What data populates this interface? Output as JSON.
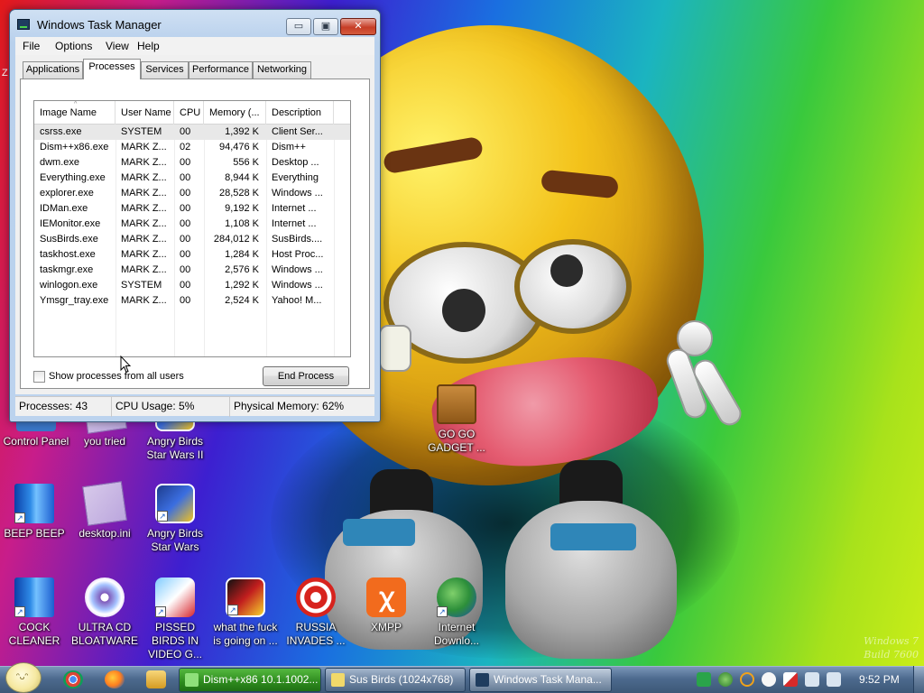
{
  "desktop": {
    "stray_text": "Z",
    "watermark": [
      "Windows 7",
      "Build 7600"
    ],
    "icons": [
      {
        "label": "Control Panel",
        "icon": "control-panel-icon"
      },
      {
        "label": "you tried",
        "icon": "text-file-icon"
      },
      {
        "label": "Angry Birds Star Wars II",
        "icon": "angry-birds-star-wars-icon"
      },
      {
        "label": "BEEP BEEP",
        "icon": "book-icon"
      },
      {
        "label": "desktop.ini",
        "icon": "ini-file-icon"
      },
      {
        "label": "Angry Birds Star Wars",
        "icon": "angry-birds-star-wars-icon"
      },
      {
        "label": "COCK CLEANER",
        "icon": "book-icon"
      },
      {
        "label": "ULTRA CD BLOATWARE",
        "icon": "cd-disc-icon"
      },
      {
        "label": "PISSED BIRDS IN VIDEO G...",
        "icon": "angry-bird-icon"
      },
      {
        "label": "what the fuck is going on ...",
        "icon": "angry-birds-space-icon"
      },
      {
        "label": "RUSSIA INVADES ...",
        "icon": "radiation-icon"
      },
      {
        "label": "XMPP",
        "icon": "xampp-icon"
      },
      {
        "label": "Internet Downlo...",
        "icon": "idm-globe-icon"
      },
      {
        "label": "GO GO GADGET ...",
        "icon": "briefcase-icon"
      }
    ]
  },
  "taskmanager": {
    "title": "Windows Task Manager",
    "caption_buttons": {
      "minimize": "▭",
      "maximize": "▣",
      "close": "✕"
    },
    "menu": [
      "File",
      "Options",
      "View",
      "Help"
    ],
    "tabs": [
      "Applications",
      "Processes",
      "Services",
      "Performance",
      "Networking"
    ],
    "active_tab": "Processes",
    "columns": [
      "Image Name",
      "User Name",
      "CPU",
      "Memory (...",
      "Description"
    ],
    "sort_indicator": "^",
    "processes": [
      {
        "name": "csrss.exe",
        "user": "SYSTEM",
        "cpu": "00",
        "memory": "1,392 K",
        "description": "Client Ser..."
      },
      {
        "name": "Dism++x86.exe",
        "user": "MARK Z...",
        "cpu": "02",
        "memory": "94,476 K",
        "description": "Dism++"
      },
      {
        "name": "dwm.exe",
        "user": "MARK Z...",
        "cpu": "00",
        "memory": "556 K",
        "description": "Desktop ..."
      },
      {
        "name": "Everything.exe",
        "user": "MARK Z...",
        "cpu": "00",
        "memory": "8,944 K",
        "description": "Everything"
      },
      {
        "name": "explorer.exe",
        "user": "MARK Z...",
        "cpu": "00",
        "memory": "28,528 K",
        "description": "Windows ..."
      },
      {
        "name": "IDMan.exe",
        "user": "MARK Z...",
        "cpu": "00",
        "memory": "9,192 K",
        "description": "Internet ..."
      },
      {
        "name": "IEMonitor.exe",
        "user": "MARK Z...",
        "cpu": "00",
        "memory": "1,108 K",
        "description": "Internet ..."
      },
      {
        "name": "SusBirds.exe",
        "user": "MARK Z...",
        "cpu": "00",
        "memory": "284,012 K",
        "description": "SusBirds...."
      },
      {
        "name": "taskhost.exe",
        "user": "MARK Z...",
        "cpu": "00",
        "memory": "1,284 K",
        "description": "Host Proc..."
      },
      {
        "name": "taskmgr.exe",
        "user": "MARK Z...",
        "cpu": "00",
        "memory": "2,576 K",
        "description": "Windows ..."
      },
      {
        "name": "winlogon.exe",
        "user": "SYSTEM",
        "cpu": "00",
        "memory": "1,292 K",
        "description": "Windows ..."
      },
      {
        "name": "Ymsgr_tray.exe",
        "user": "MARK Z...",
        "cpu": "00",
        "memory": "2,524 K",
        "description": "Yahoo! M..."
      }
    ],
    "show_all_users_label": "Show processes from all users",
    "show_all_users_checked": false,
    "end_process_label": "End Process",
    "status": {
      "processes": "Processes: 43",
      "cpu": "CPU Usage: 5%",
      "memory": "Physical Memory: 62%"
    }
  },
  "taskbar": {
    "start_label": "Start",
    "quick_launch": [
      "chrome-icon",
      "firefox-icon",
      "folder-icon"
    ],
    "tasks": [
      {
        "label": "Dism++x86 10.1.1002...",
        "icon": "dism-icon",
        "state": "progress"
      },
      {
        "label": "Sus Birds (1024x768)",
        "icon": "sus-birds-icon",
        "state": "normal"
      },
      {
        "label": "Windows Task Mana...",
        "icon": "task-manager-icon",
        "state": "active"
      }
    ],
    "tray_icons": [
      "green-square-icon",
      "network-globe-icon",
      "search-tray-icon",
      "smiley-tray-icon",
      "flag-alert-icon",
      "network-icon",
      "volume-icon"
    ],
    "clock": "9:52 PM"
  },
  "colors": {
    "taskbar": "#4d6a8e",
    "window_frame": "#bcd3ee",
    "close_button": "#c63d27",
    "progress_task": "#2d8a1e"
  }
}
